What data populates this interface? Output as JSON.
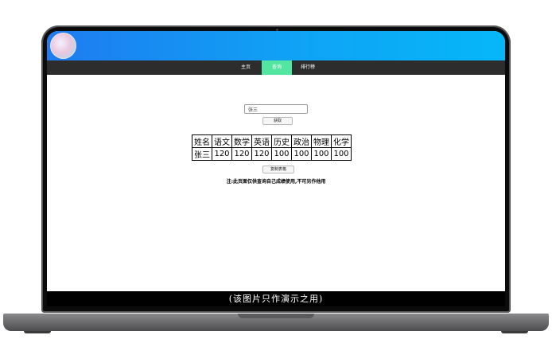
{
  "nav": {
    "items": [
      {
        "label": "主页",
        "active": false
      },
      {
        "label": "查询",
        "active": true
      },
      {
        "label": "排行榜",
        "active": false
      }
    ]
  },
  "query": {
    "name_value": "张三",
    "fetch_label": "获取",
    "copy_label": "复制表格"
  },
  "scores": {
    "headers": [
      "姓名",
      "语文",
      "数学",
      "英语",
      "历史",
      "政治",
      "物理",
      "化学"
    ],
    "rows": [
      [
        "张三",
        "120",
        "120",
        "120",
        "100",
        "100",
        "100",
        "100"
      ]
    ]
  },
  "notice": "注:此页面仅供查询自己成绩使用,不可另作他用",
  "caption": "(该图片只作演示之用)",
  "colors": {
    "header_gradient_start": "#1e7bf0",
    "header_gradient_end": "#06b7f8",
    "nav_bg": "#2d2d2d",
    "nav_active": "#52e6a0"
  }
}
